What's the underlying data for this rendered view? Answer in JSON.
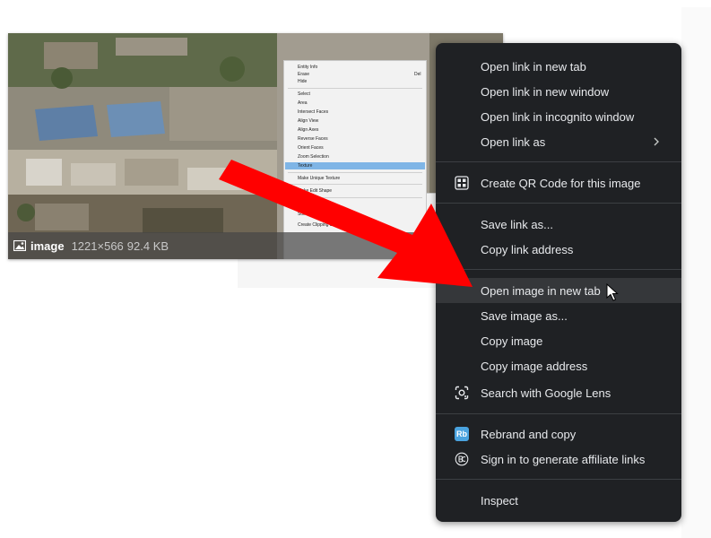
{
  "thumbnail": {
    "file_name": "image",
    "dimensions": "1221×566",
    "file_size": "92.4 KB",
    "embedded_menu": {
      "items": [
        "Entity Info",
        "Erase",
        "Hide",
        "Select",
        "Area",
        "Intersect Faces",
        "Align View",
        "Align Axes",
        "Reverse Faces",
        "Orient Faces",
        "Zoom Selection",
        "Texture",
        "Make Unique Texture",
        "Make Edit Shape",
        "Intersect",
        "Solid",
        "Create Clipping Boundary"
      ],
      "shortcut": "Del"
    }
  },
  "context_menu": {
    "groups": [
      [
        {
          "label": "Open link in new tab",
          "icon": ""
        },
        {
          "label": "Open link in new window",
          "icon": ""
        },
        {
          "label": "Open link in incognito window",
          "icon": ""
        },
        {
          "label": "Open link as",
          "icon": "",
          "submenu": true
        }
      ],
      [
        {
          "label": "Create QR Code for this image",
          "icon": "qr-code-icon"
        }
      ],
      [
        {
          "label": "Save link as...",
          "icon": ""
        },
        {
          "label": "Copy link address",
          "icon": ""
        }
      ],
      [
        {
          "label": "Open image in new tab",
          "icon": "",
          "hovered": true
        },
        {
          "label": "Save image as...",
          "icon": ""
        },
        {
          "label": "Copy image",
          "icon": ""
        },
        {
          "label": "Copy image address",
          "icon": ""
        },
        {
          "label": "Search with Google Lens",
          "icon": "google-lens-icon"
        }
      ],
      [
        {
          "label": "Rebrand and copy",
          "icon": "rebrandly-icon"
        },
        {
          "label": "Sign in to generate affiliate links",
          "icon": "affiliate-icon"
        }
      ],
      [
        {
          "label": "Inspect",
          "icon": ""
        }
      ]
    ]
  },
  "icons": {
    "rebrandly_badge": "Rb"
  },
  "colors": {
    "menu_bg": "#1f2124",
    "menu_text": "#e8eaed",
    "hover_bg": "#35373a",
    "annotation_arrow": "#ff0000",
    "rebrandly_blue": "#4aa3df"
  }
}
